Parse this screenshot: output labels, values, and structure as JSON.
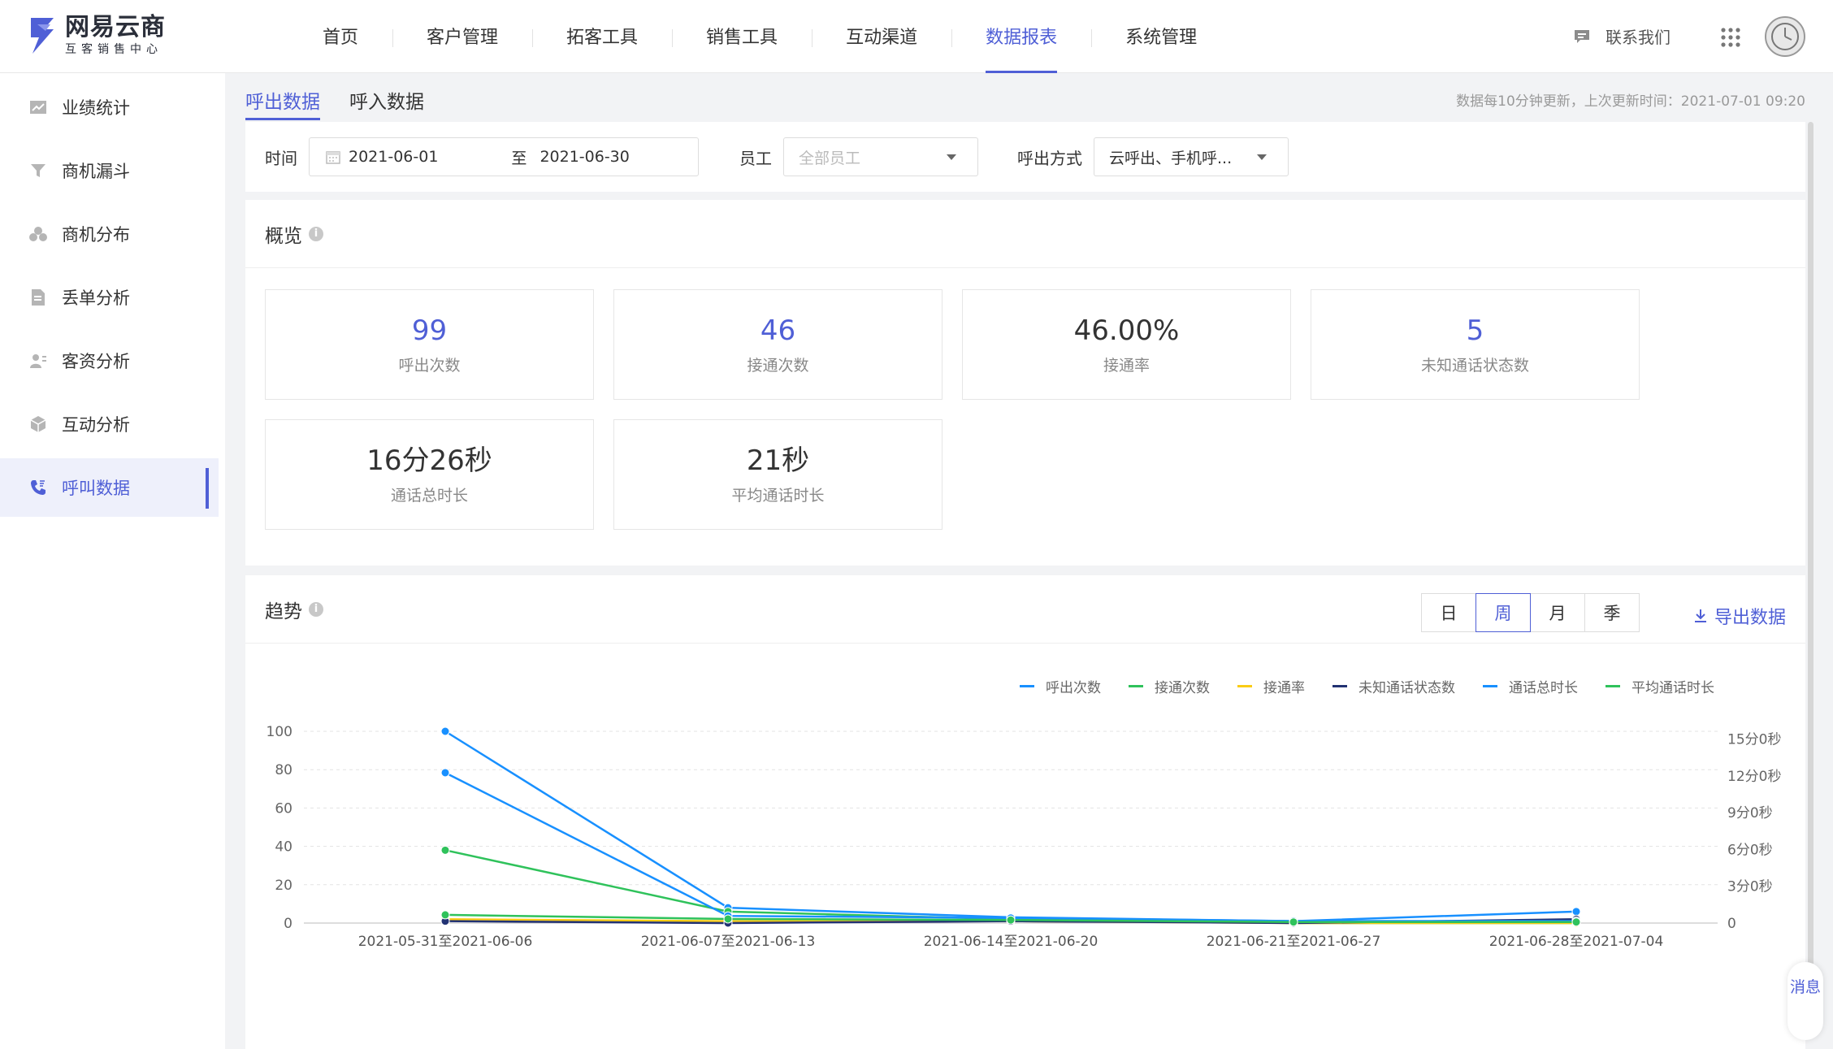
{
  "brand": {
    "name": "网易云商",
    "subtitle": "互客销售中心",
    "color": "#4f5fd6"
  },
  "nav": [
    {
      "label": "首页",
      "active": false
    },
    {
      "label": "客户管理",
      "active": false
    },
    {
      "label": "拓客工具",
      "active": false
    },
    {
      "label": "销售工具",
      "active": false
    },
    {
      "label": "互动渠道",
      "active": false
    },
    {
      "label": "数据报表",
      "active": true
    },
    {
      "label": "系统管理",
      "active": false
    }
  ],
  "header": {
    "contact_label": "联系我们",
    "contact_icon": "chat-icon",
    "apps_icon": "grid-icon"
  },
  "sidebar": {
    "items": [
      {
        "label": "业绩统计",
        "icon": "line-chart-icon",
        "active": false
      },
      {
        "label": "商机漏斗",
        "icon": "funnel-icon",
        "active": false
      },
      {
        "label": "商机分布",
        "icon": "cluster-icon",
        "active": false
      },
      {
        "label": "丢单分析",
        "icon": "document-icon",
        "active": false
      },
      {
        "label": "客资分析",
        "icon": "user-list-icon",
        "active": false
      },
      {
        "label": "互动分析",
        "icon": "cube-icon",
        "active": false
      },
      {
        "label": "呼叫数据",
        "icon": "phone-icon",
        "active": true
      }
    ]
  },
  "tabs": [
    {
      "label": "呼出数据",
      "active": true
    },
    {
      "label": "呼入数据",
      "active": false
    }
  ],
  "update_note": "数据每10分钟更新，上次更新时间：2021-07-01 09:20",
  "filters": {
    "time_label": "时间",
    "start_date": "2021-06-01",
    "range_sep": "至",
    "end_date": "2021-06-30",
    "staff_label": "员工",
    "staff_placeholder": "全部员工",
    "call_mode_label": "呼出方式",
    "call_mode_value": "云呼出、手机呼..."
  },
  "overview": {
    "title": "概览",
    "stats": [
      {
        "value": "99",
        "label": "呼出次数"
      },
      {
        "value": "46",
        "label": "接通次数"
      },
      {
        "value": "46.00%",
        "label": "接通率"
      },
      {
        "value": "5",
        "label": "未知通话状态数"
      },
      {
        "value": "16分26秒",
        "label": "通话总时长"
      },
      {
        "value": "21秒",
        "label": "平均通话时长"
      }
    ]
  },
  "trend": {
    "title": "趋势",
    "granularity": [
      "日",
      "周",
      "月",
      "季"
    ],
    "active_granularity": "周",
    "export_label": "导出数据"
  },
  "chart_data": {
    "type": "line",
    "categories": [
      "2021-05-31至2021-06-06",
      "2021-06-07至2021-06-13",
      "2021-06-14至2021-06-20",
      "2021-06-21至2021-06-27",
      "2021-06-28至2021-07-04"
    ],
    "left_axis": {
      "ticks": [
        "0",
        "20",
        "40",
        "60",
        "80",
        "100"
      ],
      "ylim": [
        0,
        100
      ]
    },
    "right_axis": {
      "ticks": [
        "0",
        "3分0秒",
        "6分0秒",
        "9分0秒",
        "12分0秒",
        "15分0秒"
      ],
      "ylim_seconds": [
        0,
        900
      ]
    },
    "grid": true,
    "legend_position": "top-right",
    "series": [
      {
        "name": "呼出次数",
        "color": "#1890ff",
        "axis": "left",
        "values": [
          100,
          8,
          3,
          1,
          6
        ]
      },
      {
        "name": "接通次数",
        "color": "#2fc25b",
        "axis": "left",
        "values": [
          38,
          6,
          2,
          0,
          0
        ]
      },
      {
        "name": "接通率",
        "color": "#facc14",
        "axis": "left",
        "values": [
          2,
          1,
          1,
          0,
          0
        ]
      },
      {
        "name": "未知通话状态数",
        "color": "#223273",
        "axis": "left",
        "values": [
          1,
          0,
          1,
          0,
          2
        ]
      },
      {
        "name": "通话总时长",
        "color": "#1890ff",
        "axis": "right",
        "values": [
          735,
          35,
          25,
          10,
          10
        ]
      },
      {
        "name": "平均通话时长",
        "color": "#2fc25b",
        "axis": "right",
        "values": [
          40,
          20,
          15,
          5,
          5
        ]
      }
    ]
  },
  "message_button": "消息"
}
